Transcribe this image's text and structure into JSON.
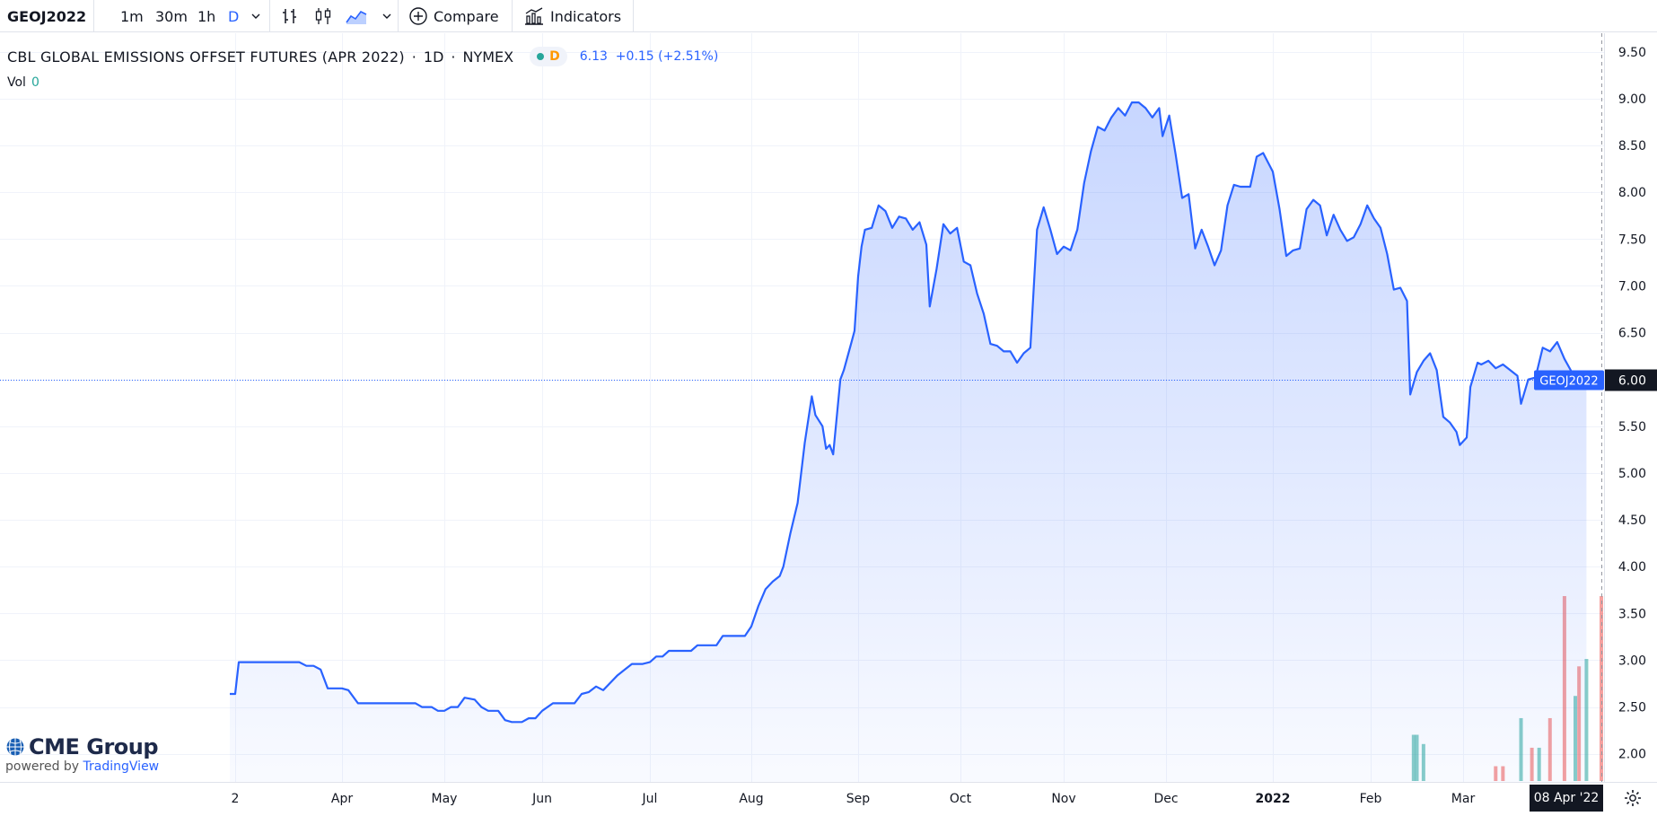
{
  "toolbar": {
    "symbol": "GEOJ2022",
    "intervals": [
      "1m",
      "30m",
      "1h",
      "D"
    ],
    "active_interval": "D",
    "compare_label": "Compare",
    "indicators_label": "Indicators"
  },
  "legend": {
    "title": "CBL GLOBAL EMISSIONS OFFSET FUTURES (APR 2022)",
    "sep1": "·",
    "resolution": "1D",
    "sep2": "·",
    "exchange": "NYMEX",
    "status_letter": "D",
    "change": "6.13  +0.15 (+2.51%)"
  },
  "volume": {
    "label": "Vol",
    "value": "0"
  },
  "branding": {
    "company": "CME Group",
    "powered_by": "powered by",
    "platform": "TradingView"
  },
  "crosshair": {
    "date_label": "08 Apr '22"
  },
  "chart_data": {
    "type": "area",
    "ylim": [
      1.7,
      9.7
    ],
    "y_ticks": [
      2.0,
      2.5,
      3.0,
      3.5,
      4.0,
      4.5,
      5.0,
      5.5,
      6.0,
      6.5,
      7.0,
      7.5,
      8.0,
      8.5,
      9.0,
      9.5
    ],
    "y_tick_labels": [
      "2.00",
      "2.50",
      "3.00",
      "3.50",
      "4.00",
      "4.50",
      "5.00",
      "5.50",
      "6.00",
      "6.50",
      "7.00",
      "7.50",
      "8.00",
      "8.50",
      "9.00",
      "9.50"
    ],
    "x_ticks": [
      {
        "label": "2",
        "date": "2021-03-02",
        "bold": false
      },
      {
        "label": "Apr",
        "date": "2021-04-01",
        "bold": false
      },
      {
        "label": "May",
        "date": "2021-05-03",
        "bold": false
      },
      {
        "label": "Jun",
        "date": "2021-06-01",
        "bold": false
      },
      {
        "label": "Jul",
        "date": "2021-07-01",
        "bold": false
      },
      {
        "label": "Aug",
        "date": "2021-08-02",
        "bold": false
      },
      {
        "label": "Sep",
        "date": "2021-09-01",
        "bold": false
      },
      {
        "label": "Oct",
        "date": "2021-10-01",
        "bold": false
      },
      {
        "label": "Nov",
        "date": "2021-11-01",
        "bold": false
      },
      {
        "label": "Dec",
        "date": "2021-12-01",
        "bold": false
      },
      {
        "label": "2022",
        "date": "2022-01-03",
        "bold": true
      },
      {
        "label": "Feb",
        "date": "2022-02-01",
        "bold": false
      },
      {
        "label": "Mar",
        "date": "2022-03-01",
        "bold": false
      }
    ],
    "series": [
      {
        "symbol": "GEOJ2022",
        "color": "#2962ff",
        "data": [
          [
            "2021-02-28",
            2.64
          ],
          [
            "2021-03-02",
            2.64
          ],
          [
            "2021-03-03",
            2.98
          ],
          [
            "2021-03-10",
            2.98
          ],
          [
            "2021-03-20",
            2.98
          ],
          [
            "2021-03-22",
            2.94
          ],
          [
            "2021-03-24",
            2.94
          ],
          [
            "2021-03-26",
            2.9
          ],
          [
            "2021-03-28",
            2.7
          ],
          [
            "2021-04-01",
            2.7
          ],
          [
            "2021-04-03",
            2.68
          ],
          [
            "2021-04-06",
            2.54
          ],
          [
            "2021-04-15",
            2.54
          ],
          [
            "2021-04-24",
            2.54
          ],
          [
            "2021-04-26",
            2.5
          ],
          [
            "2021-04-29",
            2.5
          ],
          [
            "2021-05-01",
            2.46
          ],
          [
            "2021-05-03",
            2.46
          ],
          [
            "2021-05-05",
            2.5
          ],
          [
            "2021-05-07",
            2.5
          ],
          [
            "2021-05-09",
            2.6
          ],
          [
            "2021-05-12",
            2.58
          ],
          [
            "2021-05-14",
            2.5
          ],
          [
            "2021-05-16",
            2.46
          ],
          [
            "2021-05-19",
            2.46
          ],
          [
            "2021-05-21",
            2.36
          ],
          [
            "2021-05-23",
            2.34
          ],
          [
            "2021-05-26",
            2.34
          ],
          [
            "2021-05-28",
            2.38
          ],
          [
            "2021-05-30",
            2.38
          ],
          [
            "2021-06-01",
            2.46
          ],
          [
            "2021-06-04",
            2.54
          ],
          [
            "2021-06-10",
            2.54
          ],
          [
            "2021-06-12",
            2.64
          ],
          [
            "2021-06-14",
            2.66
          ],
          [
            "2021-06-16",
            2.72
          ],
          [
            "2021-06-18",
            2.68
          ],
          [
            "2021-06-20",
            2.76
          ],
          [
            "2021-06-22",
            2.84
          ],
          [
            "2021-06-24",
            2.9
          ],
          [
            "2021-06-26",
            2.96
          ],
          [
            "2021-06-29",
            2.96
          ],
          [
            "2021-07-01",
            2.98
          ],
          [
            "2021-07-03",
            3.04
          ],
          [
            "2021-07-05",
            3.04
          ],
          [
            "2021-07-07",
            3.1
          ],
          [
            "2021-07-14",
            3.1
          ],
          [
            "2021-07-16",
            3.16
          ],
          [
            "2021-07-22",
            3.16
          ],
          [
            "2021-07-24",
            3.26
          ],
          [
            "2021-07-31",
            3.26
          ],
          [
            "2021-08-02",
            3.36
          ],
          [
            "2021-08-04",
            3.58
          ],
          [
            "2021-08-06",
            3.76
          ],
          [
            "2021-08-08",
            3.84
          ],
          [
            "2021-08-10",
            3.9
          ],
          [
            "2021-08-11",
            4.0
          ],
          [
            "2021-08-13",
            4.36
          ],
          [
            "2021-08-15",
            4.68
          ],
          [
            "2021-08-17",
            5.32
          ],
          [
            "2021-08-19",
            5.82
          ],
          [
            "2021-08-20",
            5.62
          ],
          [
            "2021-08-22",
            5.5
          ],
          [
            "2021-08-23",
            5.26
          ],
          [
            "2021-08-24",
            5.3
          ],
          [
            "2021-08-25",
            5.2
          ],
          [
            "2021-08-27",
            6.0
          ],
          [
            "2021-08-28",
            6.1
          ],
          [
            "2021-08-30",
            6.38
          ],
          [
            "2021-08-31",
            6.52
          ],
          [
            "2021-09-01",
            7.1
          ],
          [
            "2021-09-02",
            7.42
          ],
          [
            "2021-09-03",
            7.6
          ],
          [
            "2021-09-05",
            7.62
          ],
          [
            "2021-09-07",
            7.86
          ],
          [
            "2021-09-09",
            7.8
          ],
          [
            "2021-09-11",
            7.62
          ],
          [
            "2021-09-13",
            7.74
          ],
          [
            "2021-09-15",
            7.72
          ],
          [
            "2021-09-17",
            7.6
          ],
          [
            "2021-09-19",
            7.68
          ],
          [
            "2021-09-21",
            7.44
          ],
          [
            "2021-09-22",
            6.78
          ],
          [
            "2021-09-24",
            7.18
          ],
          [
            "2021-09-26",
            7.66
          ],
          [
            "2021-09-28",
            7.56
          ],
          [
            "2021-09-30",
            7.62
          ],
          [
            "2021-10-02",
            7.26
          ],
          [
            "2021-10-04",
            7.22
          ],
          [
            "2021-10-06",
            6.92
          ],
          [
            "2021-10-08",
            6.7
          ],
          [
            "2021-10-10",
            6.38
          ],
          [
            "2021-10-12",
            6.36
          ],
          [
            "2021-10-14",
            6.3
          ],
          [
            "2021-10-16",
            6.3
          ],
          [
            "2021-10-18",
            6.18
          ],
          [
            "2021-10-20",
            6.28
          ],
          [
            "2021-10-22",
            6.34
          ],
          [
            "2021-10-24",
            7.6
          ],
          [
            "2021-10-26",
            7.84
          ],
          [
            "2021-10-28",
            7.6
          ],
          [
            "2021-10-30",
            7.34
          ],
          [
            "2021-11-01",
            7.42
          ],
          [
            "2021-11-03",
            7.38
          ],
          [
            "2021-11-05",
            7.6
          ],
          [
            "2021-11-07",
            8.1
          ],
          [
            "2021-11-09",
            8.44
          ],
          [
            "2021-11-11",
            8.7
          ],
          [
            "2021-11-13",
            8.66
          ],
          [
            "2021-11-15",
            8.8
          ],
          [
            "2021-11-17",
            8.9
          ],
          [
            "2021-11-19",
            8.82
          ],
          [
            "2021-11-21",
            8.96
          ],
          [
            "2021-11-23",
            8.96
          ],
          [
            "2021-11-25",
            8.9
          ],
          [
            "2021-11-27",
            8.8
          ],
          [
            "2021-11-29",
            8.9
          ],
          [
            "2021-11-30",
            8.6
          ],
          [
            "2021-12-02",
            8.82
          ],
          [
            "2021-12-04",
            8.4
          ],
          [
            "2021-12-06",
            7.94
          ],
          [
            "2021-12-08",
            7.98
          ],
          [
            "2021-12-10",
            7.4
          ],
          [
            "2021-12-12",
            7.6
          ],
          [
            "2021-12-14",
            7.42
          ],
          [
            "2021-12-16",
            7.22
          ],
          [
            "2021-12-18",
            7.38
          ],
          [
            "2021-12-20",
            7.86
          ],
          [
            "2021-12-22",
            8.08
          ],
          [
            "2021-12-24",
            8.06
          ],
          [
            "2021-12-27",
            8.06
          ],
          [
            "2021-12-29",
            8.38
          ],
          [
            "2021-12-31",
            8.42
          ],
          [
            "2022-01-03",
            8.22
          ],
          [
            "2022-01-05",
            7.82
          ],
          [
            "2022-01-07",
            7.32
          ],
          [
            "2022-01-09",
            7.38
          ],
          [
            "2022-01-11",
            7.4
          ],
          [
            "2022-01-13",
            7.82
          ],
          [
            "2022-01-15",
            7.92
          ],
          [
            "2022-01-17",
            7.86
          ],
          [
            "2022-01-19",
            7.54
          ],
          [
            "2022-01-21",
            7.76
          ],
          [
            "2022-01-23",
            7.6
          ],
          [
            "2022-01-25",
            7.48
          ],
          [
            "2022-01-27",
            7.52
          ],
          [
            "2022-01-29",
            7.66
          ],
          [
            "2022-01-31",
            7.86
          ],
          [
            "2022-02-02",
            7.72
          ],
          [
            "2022-02-04",
            7.62
          ],
          [
            "2022-02-06",
            7.34
          ],
          [
            "2022-02-08",
            6.96
          ],
          [
            "2022-02-10",
            6.98
          ],
          [
            "2022-02-12",
            6.84
          ],
          [
            "2022-02-13",
            5.84
          ],
          [
            "2022-02-15",
            6.08
          ],
          [
            "2022-02-17",
            6.2
          ],
          [
            "2022-02-19",
            6.28
          ],
          [
            "2022-02-21",
            6.1
          ],
          [
            "2022-02-23",
            5.6
          ],
          [
            "2022-02-25",
            5.54
          ],
          [
            "2022-02-27",
            5.44
          ],
          [
            "2022-02-28",
            5.3
          ],
          [
            "2022-03-02",
            5.38
          ],
          [
            "2022-03-03",
            5.92
          ],
          [
            "2022-03-05",
            6.18
          ],
          [
            "2022-03-06",
            6.16
          ],
          [
            "2022-03-08",
            6.2
          ],
          [
            "2022-03-10",
            6.12
          ],
          [
            "2022-03-12",
            6.16
          ],
          [
            "2022-03-14",
            6.1
          ],
          [
            "2022-03-16",
            6.04
          ],
          [
            "2022-03-17",
            5.74
          ],
          [
            "2022-03-19",
            6.0
          ],
          [
            "2022-03-21",
            6.02
          ],
          [
            "2022-03-23",
            6.34
          ],
          [
            "2022-03-25",
            6.3
          ],
          [
            "2022-03-27",
            6.4
          ],
          [
            "2022-03-29",
            6.22
          ],
          [
            "2022-03-31",
            6.08
          ],
          [
            "2022-04-04",
            6.0
          ]
        ]
      }
    ],
    "volume_bars": [
      {
        "date": "2022-02-14",
        "height_pct": 0.25,
        "color": "#26a69a"
      },
      {
        "date": "2022-02-15",
        "height_pct": 0.25,
        "color": "#26a69a"
      },
      {
        "date": "2022-02-17",
        "height_pct": 0.2,
        "color": "#26a69a"
      },
      {
        "date": "2022-03-10",
        "height_pct": 0.08,
        "color": "#ef5350"
      },
      {
        "date": "2022-03-12",
        "height_pct": 0.08,
        "color": "#ef5350"
      },
      {
        "date": "2022-03-17",
        "height_pct": 0.34,
        "color": "#26a69a"
      },
      {
        "date": "2022-03-20",
        "height_pct": 0.18,
        "color": "#ef5350"
      },
      {
        "date": "2022-03-22",
        "height_pct": 0.18,
        "color": "#26a69a"
      },
      {
        "date": "2022-03-25",
        "height_pct": 0.34,
        "color": "#ef5350"
      },
      {
        "date": "2022-03-29",
        "height_pct": 1.0,
        "color": "#ef5350"
      },
      {
        "date": "2022-04-01",
        "height_pct": 0.46,
        "color": "#26a69a"
      },
      {
        "date": "2022-04-02",
        "height_pct": 0.62,
        "color": "#ef5350"
      },
      {
        "date": "2022-04-04",
        "height_pct": 0.66,
        "color": "#26a69a"
      },
      {
        "date": "2022-04-08",
        "height_pct": 1.0,
        "color": "#ef5350"
      }
    ],
    "last_price_line": 6.0,
    "last_price_label": "6.00",
    "symbol_label": "GEOJ2022",
    "crosshair_date": "2022-04-08"
  }
}
